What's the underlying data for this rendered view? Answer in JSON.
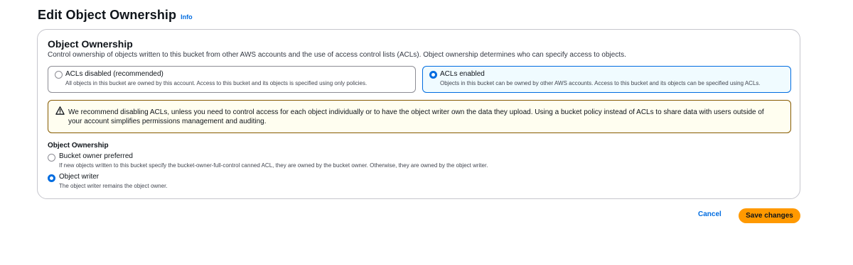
{
  "header": {
    "title": "Edit Object Ownership",
    "info_label": "Info"
  },
  "panel": {
    "title": "Object Ownership",
    "description": "Control ownership of objects written to this bucket from other AWS accounts and the use of access control lists (ACLs). Object ownership determines who can specify access to objects.",
    "tiles": [
      {
        "label": "ACLs disabled (recommended)",
        "description": "All objects in this bucket are owned by this account. Access to this bucket and its objects is specified using only policies.",
        "selected": false
      },
      {
        "label": "ACLs enabled",
        "description": "Objects in this bucket can be owned by other AWS accounts. Access to this bucket and its objects can be specified using ACLs.",
        "selected": true
      }
    ],
    "alert": {
      "icon": "warning-icon",
      "text": "We recommend disabling ACLs, unless you need to control access for each object individually or to have the object writer own the data they upload. Using a bucket policy instead of ACLs to share data with users outside of your account simplifies permissions management and auditing."
    },
    "ownership_group": {
      "label": "Object Ownership",
      "options": [
        {
          "label": "Bucket owner preferred",
          "description": "If new objects written to this bucket specify the bucket-owner-full-control canned ACL, they are owned by the bucket owner. Otherwise, they are owned by the object writer.",
          "selected": false
        },
        {
          "label": "Object writer",
          "description": "The object writer remains the object owner.",
          "selected": true
        }
      ]
    }
  },
  "actions": {
    "cancel_label": "Cancel",
    "save_label": "Save changes"
  },
  "colors": {
    "accent": "#006ce0",
    "primary_button": "#ff9900",
    "warning_border": "#855900",
    "warning_background": "#fffef0"
  }
}
